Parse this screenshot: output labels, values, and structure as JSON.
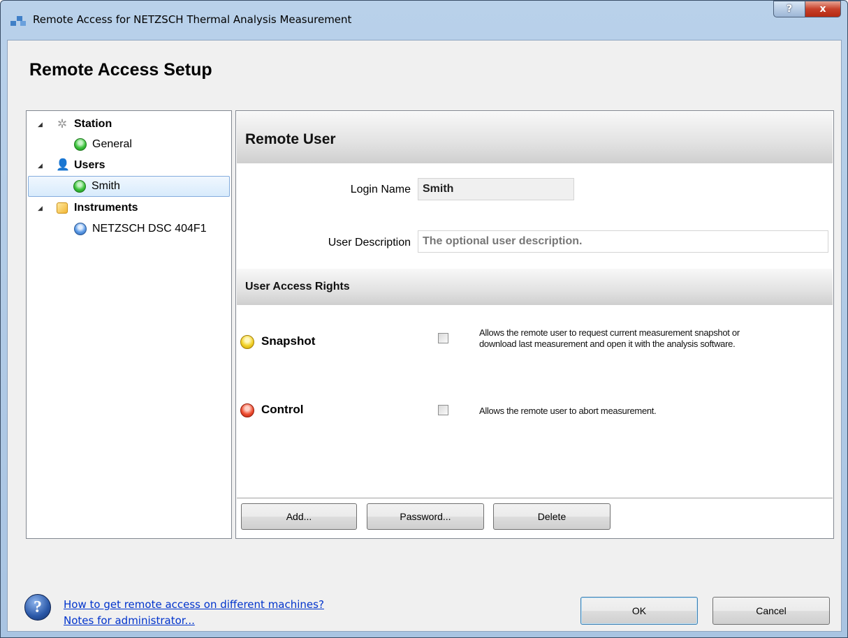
{
  "window": {
    "title": "Remote Access for NETZSCH Thermal Analysis Measurement",
    "help_glyph": "?",
    "close_glyph": "x"
  },
  "heading": "Remote Access Setup",
  "tree": {
    "station": {
      "label": "Station",
      "children": [
        {
          "label": "General",
          "status": "green"
        }
      ]
    },
    "users": {
      "label": "Users",
      "children": [
        {
          "label": "Smith",
          "status": "green",
          "selected": true
        }
      ]
    },
    "instruments": {
      "label": "Instruments",
      "children": [
        {
          "label": "NETZSCH DSC 404F1",
          "status": "blue"
        }
      ]
    },
    "expander_glyph": "◢"
  },
  "panel": {
    "title": "Remote User",
    "login_name_label": "Login Name",
    "login_name_value": "Smith",
    "user_description_label": "User Description",
    "user_description_placeholder": "The optional user description.",
    "access_rights_title": "User Access Rights",
    "rights": [
      {
        "name": "Snapshot",
        "status": "yellow",
        "checked": false,
        "description_line1": "Allows the remote user to request current measurement snapshot or",
        "description_line2": "download last measurement and open it with the analysis software."
      },
      {
        "name": "Control",
        "status": "red",
        "checked": false,
        "description_line1": "Allows the remote user to abort measurement."
      }
    ],
    "buttons": {
      "add": "Add...",
      "password": "Password...",
      "delete": "Delete"
    }
  },
  "footer": {
    "help_glyph": "?",
    "link_remote": "How to get remote access on different machines?",
    "link_admin": "Notes for administrator...",
    "ok": "OK",
    "cancel": "Cancel"
  },
  "colors": {
    "link": "#0033cc",
    "selection": "#d8ebfc",
    "green": "#3cc33c",
    "blue": "#5b9ae6",
    "yellow": "#f2d22a",
    "red": "#ef4f33"
  }
}
